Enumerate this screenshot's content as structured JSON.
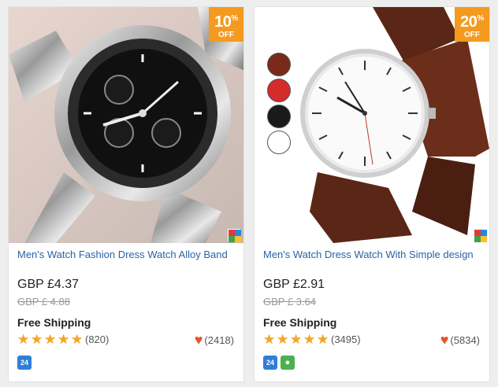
{
  "products": [
    {
      "discount": "10",
      "discount_off": "OFF",
      "title": "Men's Watch Fashion Dress Watch Alloy Band",
      "price": "GBP £4.37",
      "old_price": "GBP £ 4.88",
      "shipping": "Free Shipping",
      "rating_stars": 5,
      "reviews": "(820)",
      "likes": "(2418)",
      "badge_24": "24"
    },
    {
      "discount": "20",
      "discount_off": "OFF",
      "title": "Men's Watch Dress Watch With Simple design",
      "price": "GBP £2.91",
      "old_price": "GBP £ 3.64",
      "shipping": "Free Shipping",
      "rating_stars": 5,
      "reviews": "(3495)",
      "likes": "(5834)",
      "badge_24": "24",
      "color_swatches": [
        "#7a2a1a",
        "#d42b2b",
        "#1a1a1a",
        "#ffffff"
      ]
    }
  ],
  "colors": {
    "accent_badge": "#f39a1f",
    "title_link": "#2a63a6",
    "star": "#f5a623",
    "heart": "#e5532d"
  },
  "icons": {
    "star": "★",
    "heart": "♥",
    "location": "📍"
  }
}
